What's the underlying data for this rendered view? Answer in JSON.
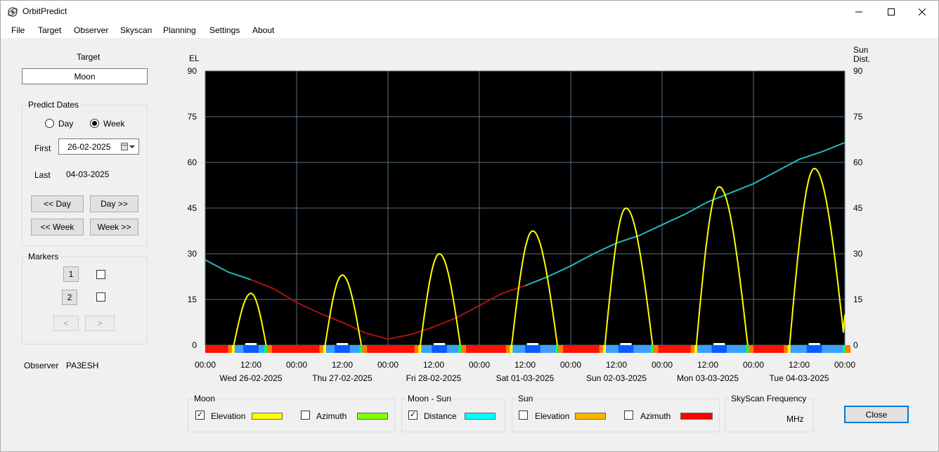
{
  "window": {
    "title": "OrbitPredict"
  },
  "menu": [
    "File",
    "Target",
    "Observer",
    "Skyscan",
    "Planning",
    "Settings",
    "About"
  ],
  "left": {
    "target_label": "Target",
    "target_value": "Moon",
    "predict_dates": {
      "title": "Predict Dates",
      "day_label": "Day",
      "week_label": "Week",
      "selected": "Week",
      "first_label": "First",
      "first_value": "26-02-2025",
      "last_label": "Last",
      "last_value": "04-03-2025",
      "btn_prev_day": "<< Day",
      "btn_next_day": "Day >>",
      "btn_prev_week": "<< Week",
      "btn_next_week": "Week >>"
    },
    "markers": {
      "title": "Markers",
      "marker1": "1",
      "marker2": "2",
      "prev": "<",
      "next": ">"
    },
    "observer_label": "Observer",
    "observer_value": "PA3ESH"
  },
  "legend": {
    "moon": {
      "title": "Moon",
      "elevation": "Elevation",
      "elevation_checked": true,
      "elevation_color": "#ffff00",
      "azimuth": "Azimuth",
      "azimuth_checked": false,
      "azimuth_color": "#7fff00"
    },
    "moon_sun": {
      "title": "Moon  - Sun",
      "distance": "Distance",
      "distance_checked": true,
      "distance_color": "#00ffff"
    },
    "sun": {
      "title": "Sun",
      "elevation": "Elevation",
      "elevation_checked": false,
      "elevation_color": "#ffb300",
      "azimuth": "Azimuth",
      "azimuth_checked": false,
      "azimuth_color": "#ff0000"
    },
    "skyscan": {
      "title": "SkyScan Frequency",
      "unit": "MHz"
    }
  },
  "close_button": "Close",
  "chart_data": {
    "type": "line",
    "ylabel_left": "EL",
    "ylabel_right_line1": "Sun",
    "ylabel_right_line2": "Dist.",
    "ylim": [
      0,
      90
    ],
    "y_ticks": [
      0,
      15,
      30,
      45,
      60,
      75,
      90
    ],
    "x_hours_range": [
      0,
      168
    ],
    "x_tick_labels": [
      "00:00",
      "12:00",
      "00:00",
      "12:00",
      "00:00",
      "12:00",
      "00:00",
      "12:00",
      "00:00",
      "12:00",
      "00:00",
      "12:00",
      "00:00",
      "12:00",
      "00:00"
    ],
    "day_labels": [
      "Wed 26-02-2025",
      "Thu 27-02-2025",
      "Fri 28-02-2025",
      "Sat 01-03-2025",
      "Sun 02-03-2025",
      "Mon 03-03-2025",
      "Tue 04-03-2025"
    ],
    "grid": true,
    "background": "#000000",
    "series": [
      {
        "name": "Elevation",
        "color": "#ffff00",
        "passes": [
          {
            "rise": 7.5,
            "peak_hour": 12.0,
            "peak": 17,
            "set": 16.0
          },
          {
            "rise": 31.5,
            "peak_hour": 36.0,
            "peak": 23,
            "set": 41.0
          },
          {
            "rise": 56.5,
            "peak_hour": 61.5,
            "peak": 30,
            "set": 67.0
          },
          {
            "rise": 80.5,
            "peak_hour": 86.0,
            "peak": 37.5,
            "set": 92.5
          },
          {
            "rise": 105.0,
            "peak_hour": 110.5,
            "peak": 45,
            "set": 117.5
          },
          {
            "rise": 129.0,
            "peak_hour": 135.0,
            "peak": 52,
            "set": 142.5
          },
          {
            "rise": 153.5,
            "peak_hour": 160.0,
            "peak": 58,
            "set": 168.0,
            "end_value": 10
          }
        ]
      },
      {
        "name": "Distance",
        "color_visible": "#20b8c0",
        "color_below": "#b01010",
        "points": [
          [
            0,
            28
          ],
          [
            6,
            24
          ],
          [
            12,
            21.5
          ],
          [
            18,
            18.5
          ],
          [
            24,
            14
          ],
          [
            30,
            10.5
          ],
          [
            36,
            7.5
          ],
          [
            42,
            4
          ],
          [
            48,
            2
          ],
          [
            54,
            3.5
          ],
          [
            60,
            6
          ],
          [
            66,
            9
          ],
          [
            72,
            13
          ],
          [
            78,
            17
          ],
          [
            84,
            19.5
          ],
          [
            90,
            22.5
          ],
          [
            96,
            26
          ],
          [
            102,
            30
          ],
          [
            108,
            33.5
          ],
          [
            114,
            36
          ],
          [
            120,
            39.5
          ],
          [
            126,
            43
          ],
          [
            132,
            47
          ],
          [
            138,
            50
          ],
          [
            144,
            53
          ],
          [
            150,
            57
          ],
          [
            156,
            61
          ],
          [
            162,
            63.5
          ],
          [
            168,
            66.5
          ]
        ]
      }
    ]
  }
}
